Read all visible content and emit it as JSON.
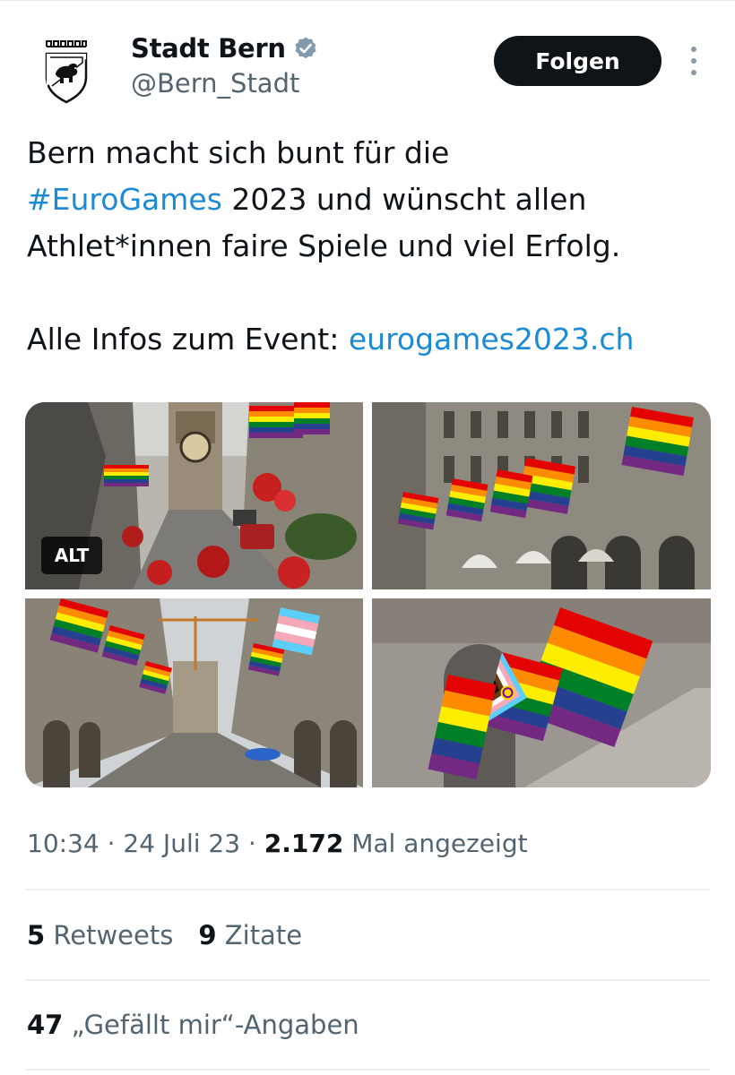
{
  "account": {
    "display_name": "Stadt Bern",
    "handle": "@Bern_Stadt",
    "follow_label": "Folgen"
  },
  "tweet": {
    "line1": "Bern macht sich bunt für die",
    "hashtag": "#EuroGames",
    "line2_rest": " 2023 und wünscht allen",
    "line3": "Athlet*innen faire Spiele und viel Erfolg.",
    "line4_prefix": "Alle Infos zum Event: ",
    "link": "eurogames2023.ch"
  },
  "media": {
    "alt_badge": "ALT",
    "flag_colors": [
      "#e40303",
      "#ff8c00",
      "#ffed00",
      "#008026",
      "#24408e",
      "#732982"
    ]
  },
  "meta": {
    "time": "10:34",
    "sep1": " · ",
    "date": "24 Juli 23",
    "sep2": " · ",
    "views_count": "2.172",
    "views_label": " Mal angezeigt"
  },
  "stats": {
    "retweets_count": "5",
    "retweets_label": " Retweets",
    "quotes_count": "9",
    "quotes_label": " Zitate",
    "likes_count": "47",
    "likes_label": " „Gefällt mir“-Angaben"
  },
  "colors": {
    "text": "#0f1419",
    "secondary": "#536471",
    "link": "#1d8bd3",
    "verified": "#829aab"
  }
}
